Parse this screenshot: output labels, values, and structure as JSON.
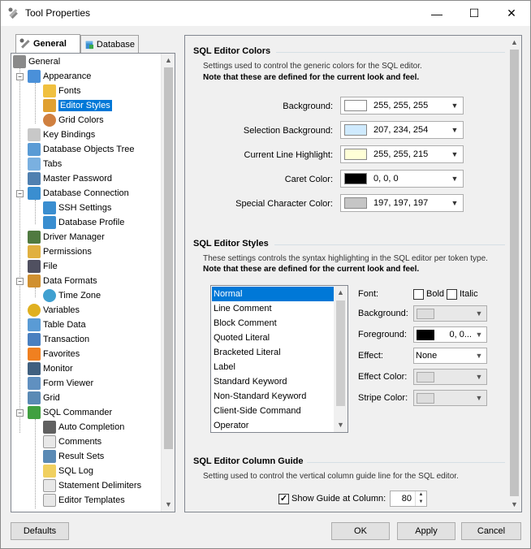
{
  "window": {
    "title": "Tool Properties",
    "minimize": "—",
    "maximize": "☐",
    "close": "✕"
  },
  "tabs": [
    {
      "label": "General"
    },
    {
      "label": "Database"
    }
  ],
  "tree": [
    {
      "label": "General"
    },
    {
      "label": "Appearance"
    },
    {
      "label": "Fonts"
    },
    {
      "label": "Editor Styles"
    },
    {
      "label": "Grid Colors"
    },
    {
      "label": "Key Bindings"
    },
    {
      "label": "Database Objects Tree"
    },
    {
      "label": "Tabs"
    },
    {
      "label": "Master Password"
    },
    {
      "label": "Database Connection"
    },
    {
      "label": "SSH Settings"
    },
    {
      "label": "Database Profile"
    },
    {
      "label": "Driver Manager"
    },
    {
      "label": "Permissions"
    },
    {
      "label": "File"
    },
    {
      "label": "Data Formats"
    },
    {
      "label": "Time Zone"
    },
    {
      "label": "Variables"
    },
    {
      "label": "Table Data"
    },
    {
      "label": "Transaction"
    },
    {
      "label": "Favorites"
    },
    {
      "label": "Monitor"
    },
    {
      "label": "Form Viewer"
    },
    {
      "label": "Grid"
    },
    {
      "label": "SQL Commander"
    },
    {
      "label": "Auto Completion"
    },
    {
      "label": "Comments"
    },
    {
      "label": "Result Sets"
    },
    {
      "label": "SQL Log"
    },
    {
      "label": "Statement Delimiters"
    },
    {
      "label": "Editor Templates"
    }
  ],
  "colors_section": {
    "title": "SQL Editor Colors",
    "desc": "Settings used to control the generic colors for the SQL editor.",
    "note": "Note that these are defined for the current look and feel.",
    "rows": [
      {
        "label": "Background:",
        "value": "255, 255, 255",
        "color": "#ffffff"
      },
      {
        "label": "Selection Background:",
        "value": "207, 234, 254",
        "color": "#cfeafe"
      },
      {
        "label": "Current Line Highlight:",
        "value": "255, 255, 215",
        "color": "#ffffd7"
      },
      {
        "label": "Caret Color:",
        "value": "0, 0, 0",
        "color": "#000000"
      },
      {
        "label": "Special Character Color:",
        "value": "197, 197, 197",
        "color": "#c5c5c5"
      }
    ]
  },
  "styles_section": {
    "title": "SQL Editor Styles",
    "desc": "These settings controls the syntax highlighting in the SQL editor per token type.",
    "note": "Note that these are defined for the current look and feel.",
    "tokens": [
      "Normal",
      "Line Comment",
      "Block Comment",
      "Quoted Literal",
      "Bracketed Literal",
      "Label",
      "Standard Keyword",
      "Non-Standard Keyword",
      "Client-Side Command",
      "Operator"
    ],
    "font_label": "Font:",
    "bold_label": "Bold",
    "italic_label": "Italic",
    "background_label": "Background:",
    "foreground_label": "Foreground:",
    "foreground_value": "0, 0...",
    "effect_label": "Effect:",
    "effect_value": "None",
    "effect_color_label": "Effect Color:",
    "stripe_color_label": "Stripe Color:"
  },
  "guide_section": {
    "title": "SQL Editor Column Guide",
    "desc": "Setting used to control the vertical column guide line for the SQL editor.",
    "show_label": "Show Guide at Column:",
    "column_value": "80"
  },
  "buttons": {
    "defaults": "Defaults",
    "ok": "OK",
    "apply": "Apply",
    "cancel": "Cancel"
  }
}
